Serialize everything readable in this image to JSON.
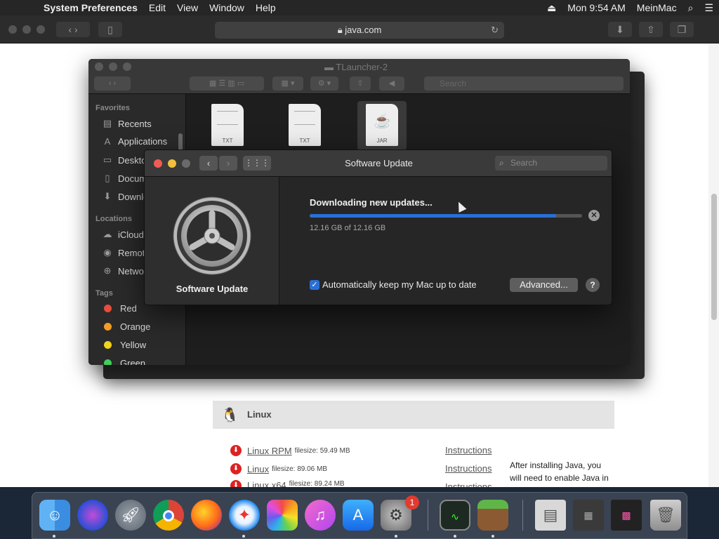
{
  "menubar": {
    "app": "System Preferences",
    "menus": [
      "Edit",
      "View",
      "Window",
      "Help"
    ],
    "clock": "Mon 9:54 AM",
    "user": "MeinMac"
  },
  "safari": {
    "url": "java.com"
  },
  "webpage": {
    "section_title": "Linux",
    "downloads": [
      {
        "name": "Linux RPM",
        "size": "filesize: 59.49 MB",
        "instructions": "Instructions"
      },
      {
        "name": "Linux",
        "size": "filesize: 89.06 MB",
        "instructions": "Instructions"
      },
      {
        "name": "Linux x64",
        "size": "filesize: 89.24 MB",
        "instructions": "Instructions"
      }
    ],
    "after_text": "After installing Java, you will need to enable Java in"
  },
  "finder": {
    "title": "TLauncher-2",
    "search_placeholder": "Search",
    "favorites_label": "Favorites",
    "favorites": [
      "Recents",
      "Applications",
      "Desktop",
      "Documents",
      "Downloads"
    ],
    "locations_label": "Locations",
    "locations": [
      "iCloud Drive",
      "Remote Disc",
      "Network"
    ],
    "tags_label": "Tags",
    "tags": [
      {
        "name": "Red",
        "color": "#e84c3d"
      },
      {
        "name": "Orange",
        "color": "#f39c28"
      },
      {
        "name": "Yellow",
        "color": "#f2d21b"
      },
      {
        "name": "Green",
        "color": "#3fcf5c"
      }
    ],
    "files": [
      "TXT",
      "TXT",
      "JAR"
    ]
  },
  "software_update": {
    "window_title": "Software Update",
    "search_placeholder": "Search",
    "pane_name": "Software Update",
    "status": "Downloading new updates...",
    "progress": 0.905,
    "size_text": "12.16 GB of 12.16 GB",
    "auto_update_label": "Automatically keep my Mac up to date",
    "auto_update_checked": true,
    "advanced_label": "Advanced...",
    "help_label": "?"
  },
  "dock": {
    "apps": [
      "Finder",
      "Siri",
      "Launchpad",
      "Chrome",
      "Firefox",
      "Safari",
      "Photos",
      "iTunes",
      "App Store",
      "System Preferences",
      "Activity Monitor",
      "Minecraft",
      "Preview",
      "Downloads Stack",
      "Screenshots Stack",
      "Trash"
    ],
    "badge": "1"
  }
}
